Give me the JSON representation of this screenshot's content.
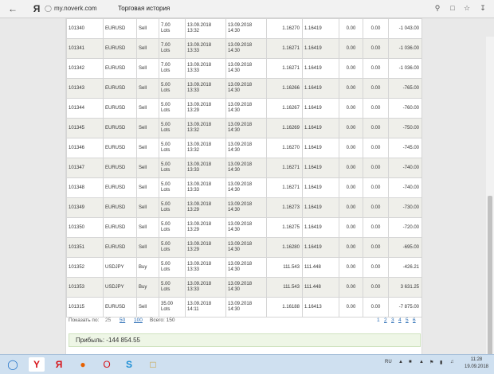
{
  "browser": {
    "url": "my.noverk.com",
    "title": "Торговая история"
  },
  "rows": [
    {
      "id": "101340",
      "symbol": "EURUSD",
      "type": "Sell",
      "lots": "7.00",
      "lots_unit": "Lots",
      "open_date": "13.09.2018",
      "open_time": "13:32",
      "close_date": "13.09.2018",
      "close_time": "14:30",
      "open_price": "1.16270",
      "close_price": "1.16419",
      "col_a": "0.00",
      "col_b": "0.00",
      "profit": "-1 043.00"
    },
    {
      "id": "101341",
      "symbol": "EURUSD",
      "type": "Sell",
      "lots": "7.00",
      "lots_unit": "Lots",
      "open_date": "13.09.2018",
      "open_time": "13:33",
      "close_date": "13.09.2018",
      "close_time": "14:30",
      "open_price": "1.16271",
      "close_price": "1.16419",
      "col_a": "0.00",
      "col_b": "0.00",
      "profit": "-1 036.00"
    },
    {
      "id": "101342",
      "symbol": "EURUSD",
      "type": "Sell",
      "lots": "7.00",
      "lots_unit": "Lots",
      "open_date": "13.09.2018",
      "open_time": "13:33",
      "close_date": "13.09.2018",
      "close_time": "14:30",
      "open_price": "1.16271",
      "close_price": "1.16419",
      "col_a": "0.00",
      "col_b": "0.00",
      "profit": "-1 036.00"
    },
    {
      "id": "101343",
      "symbol": "EURUSD",
      "type": "Sell",
      "lots": "5.00",
      "lots_unit": "Lots",
      "open_date": "13.09.2018",
      "open_time": "13:33",
      "close_date": "13.09.2018",
      "close_time": "14:30",
      "open_price": "1.16266",
      "close_price": "1.16419",
      "col_a": "0.00",
      "col_b": "0.00",
      "profit": "-765.00"
    },
    {
      "id": "101344",
      "symbol": "EURUSD",
      "type": "Sell",
      "lots": "5.00",
      "lots_unit": "Lots",
      "open_date": "13.09.2018",
      "open_time": "13:29",
      "close_date": "13.09.2018",
      "close_time": "14:30",
      "open_price": "1.16267",
      "close_price": "1.16419",
      "col_a": "0.00",
      "col_b": "0.00",
      "profit": "-760.00"
    },
    {
      "id": "101345",
      "symbol": "EURUSD",
      "type": "Sell",
      "lots": "5.00",
      "lots_unit": "Lots",
      "open_date": "13.09.2018",
      "open_time": "13:32",
      "close_date": "13.09.2018",
      "close_time": "14:30",
      "open_price": "1.16269",
      "close_price": "1.16419",
      "col_a": "0.00",
      "col_b": "0.00",
      "profit": "-750.00"
    },
    {
      "id": "101346",
      "symbol": "EURUSD",
      "type": "Sell",
      "lots": "5.00",
      "lots_unit": "Lots",
      "open_date": "13.09.2018",
      "open_time": "13:32",
      "close_date": "13.09.2018",
      "close_time": "14:30",
      "open_price": "1.16270",
      "close_price": "1.16419",
      "col_a": "0.00",
      "col_b": "0.00",
      "profit": "-745.00"
    },
    {
      "id": "101347",
      "symbol": "EURUSD",
      "type": "Sell",
      "lots": "5.00",
      "lots_unit": "Lots",
      "open_date": "13.09.2018",
      "open_time": "13:33",
      "close_date": "13.09.2018",
      "close_time": "14:30",
      "open_price": "1.16271",
      "close_price": "1.16419",
      "col_a": "0.00",
      "col_b": "0.00",
      "profit": "-740.00"
    },
    {
      "id": "101348",
      "symbol": "EURUSD",
      "type": "Sell",
      "lots": "5.00",
      "lots_unit": "Lots",
      "open_date": "13.09.2018",
      "open_time": "13:33",
      "close_date": "13.09.2018",
      "close_time": "14:30",
      "open_price": "1.16271",
      "close_price": "1.16419",
      "col_a": "0.00",
      "col_b": "0.00",
      "profit": "-740.00"
    },
    {
      "id": "101349",
      "symbol": "EURUSD",
      "type": "Sell",
      "lots": "5.00",
      "lots_unit": "Lots",
      "open_date": "13.09.2018",
      "open_time": "13:29",
      "close_date": "13.09.2018",
      "close_time": "14:30",
      "open_price": "1.16273",
      "close_price": "1.16419",
      "col_a": "0.00",
      "col_b": "0.00",
      "profit": "-730.00"
    },
    {
      "id": "101350",
      "symbol": "EURUSD",
      "type": "Sell",
      "lots": "5.00",
      "lots_unit": "Lots",
      "open_date": "13.09.2018",
      "open_time": "13:29",
      "close_date": "13.09.2018",
      "close_time": "14:30",
      "open_price": "1.16275",
      "close_price": "1.16419",
      "col_a": "0.00",
      "col_b": "0.00",
      "profit": "-720.00"
    },
    {
      "id": "101351",
      "symbol": "EURUSD",
      "type": "Sell",
      "lots": "5.00",
      "lots_unit": "Lots",
      "open_date": "13.09.2018",
      "open_time": "13:29",
      "close_date": "13.09.2018",
      "close_time": "14:30",
      "open_price": "1.16280",
      "close_price": "1.16419",
      "col_a": "0.00",
      "col_b": "0.00",
      "profit": "-695.00"
    },
    {
      "id": "101352",
      "symbol": "USDJPY",
      "type": "Buy",
      "lots": "5.00",
      "lots_unit": "Lots",
      "open_date": "13.09.2018",
      "open_time": "13:33",
      "close_date": "13.09.2018",
      "close_time": "14:30",
      "open_price": "111.543",
      "close_price": "111.448",
      "col_a": "0.00",
      "col_b": "0.00",
      "profit": "-426.21"
    },
    {
      "id": "101353",
      "symbol": "USDJPY",
      "type": "Buy",
      "lots": "5.00",
      "lots_unit": "Lots",
      "open_date": "13.09.2018",
      "open_time": "13:33",
      "close_date": "13.09.2018",
      "close_time": "14:30",
      "open_price": "111.543",
      "close_price": "111.448",
      "col_a": "0.00",
      "col_b": "0.00",
      "profit": "3 631.25"
    },
    {
      "id": "101315",
      "symbol": "EURUSD",
      "type": "Sell",
      "lots": "35.00",
      "lots_unit": "Lots",
      "open_date": "13.09.2018",
      "open_time": "14:11",
      "close_date": "13.09.2018",
      "close_time": "14:30",
      "open_price": "1.16188",
      "close_price": "1.16413",
      "col_a": "0.00",
      "col_b": "0.00",
      "profit": "-7 875.00"
    }
  ],
  "pagination": {
    "show_label": "Показать по:",
    "size_25": "25",
    "size_50": "50",
    "size_100": "100",
    "total": "Всего: 150",
    "pages": [
      "1",
      "2",
      "3",
      "4",
      "5",
      "6"
    ]
  },
  "summary": {
    "profit_text": "Прибыль: -144 854.55"
  },
  "taskbar": {
    "lang": "RU",
    "time": "11:28",
    "date": "19.09.2018"
  }
}
